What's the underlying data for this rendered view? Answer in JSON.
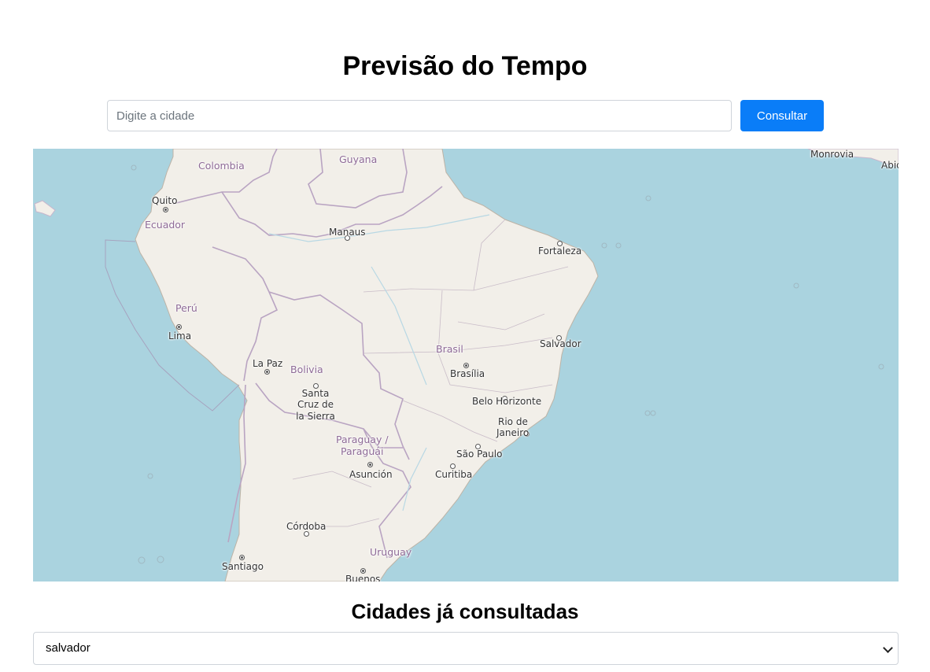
{
  "header": {
    "title": "Previsão do Tempo"
  },
  "search": {
    "placeholder": "Digite a cidade",
    "value": "",
    "button_label": "Consultar"
  },
  "map": {
    "countries": {
      "colombia": "Colombia",
      "guyana": "Guyana",
      "ecuador": "Ecuador",
      "peru": "Perú",
      "bolivia": "Bolivia",
      "brasil": "Brasil",
      "paraguay_line1": "Paraguay /",
      "paraguay_line2": "Paraguái",
      "uruguay": "Uruguay"
    },
    "cities": {
      "quito": "Quito",
      "manaus": "Manaus",
      "fortaleza": "Fortaleza",
      "lima": "Lima",
      "salvador": "Salvador",
      "brasilia": "Brasília",
      "la_paz": "La Paz",
      "santa_cruz_1": "Santa",
      "santa_cruz_2": "Cruz de",
      "santa_cruz_3": "la Sierra",
      "belo_horizonte": "Belo Horizonte",
      "rio_1": "Rio de",
      "rio_2": "Janeiro",
      "sao_paulo": "São Paulo",
      "asuncion": "Asunción",
      "curitiba": "Curitiba",
      "cordoba": "Córdoba",
      "santiago": "Santiago",
      "buenos_aires": "Buenos",
      "monrovia": "Monrovia",
      "abidjan": "Abid"
    },
    "colors": {
      "ocean": "#aad3df",
      "land": "#f2efe9",
      "border": "#b9a4c2"
    }
  },
  "history": {
    "title": "Cidades já consultadas",
    "selected": "salvador"
  }
}
